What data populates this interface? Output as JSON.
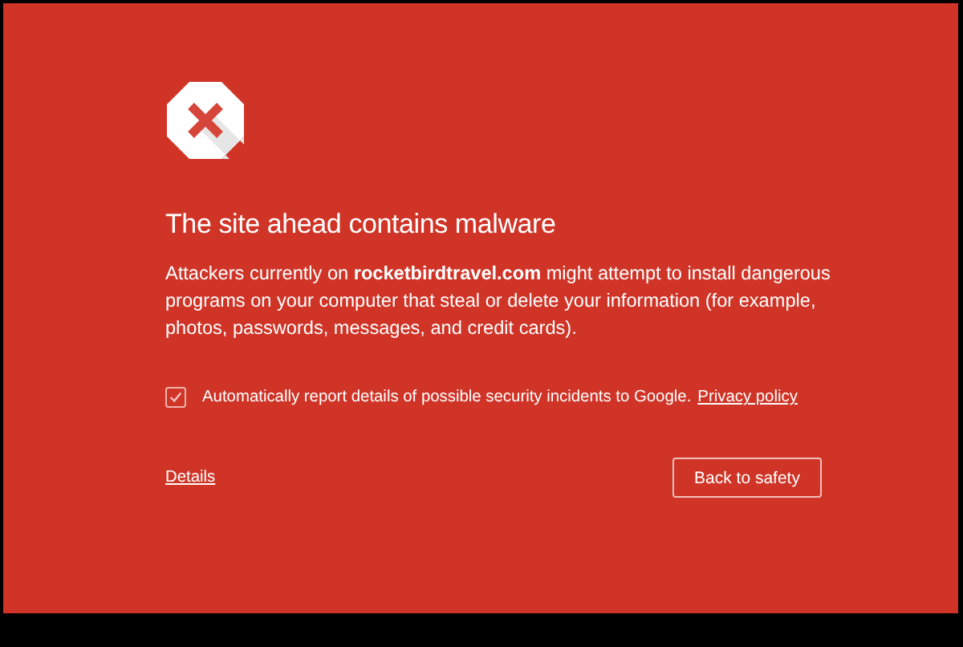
{
  "title": "The site ahead contains malware",
  "message": "Attackers currently on **rocketbirdtravel.com** might attempt to install dangerous programs on your computer that steal or delete your information (for example, photos, passwords, messages, and credit cards).",
  "report": {
    "label": "Automatically report details of possible security incidents to Google.",
    "link": "Privacy policy",
    "checked": true
  },
  "details_link": "Details",
  "button": "Back to safety"
}
